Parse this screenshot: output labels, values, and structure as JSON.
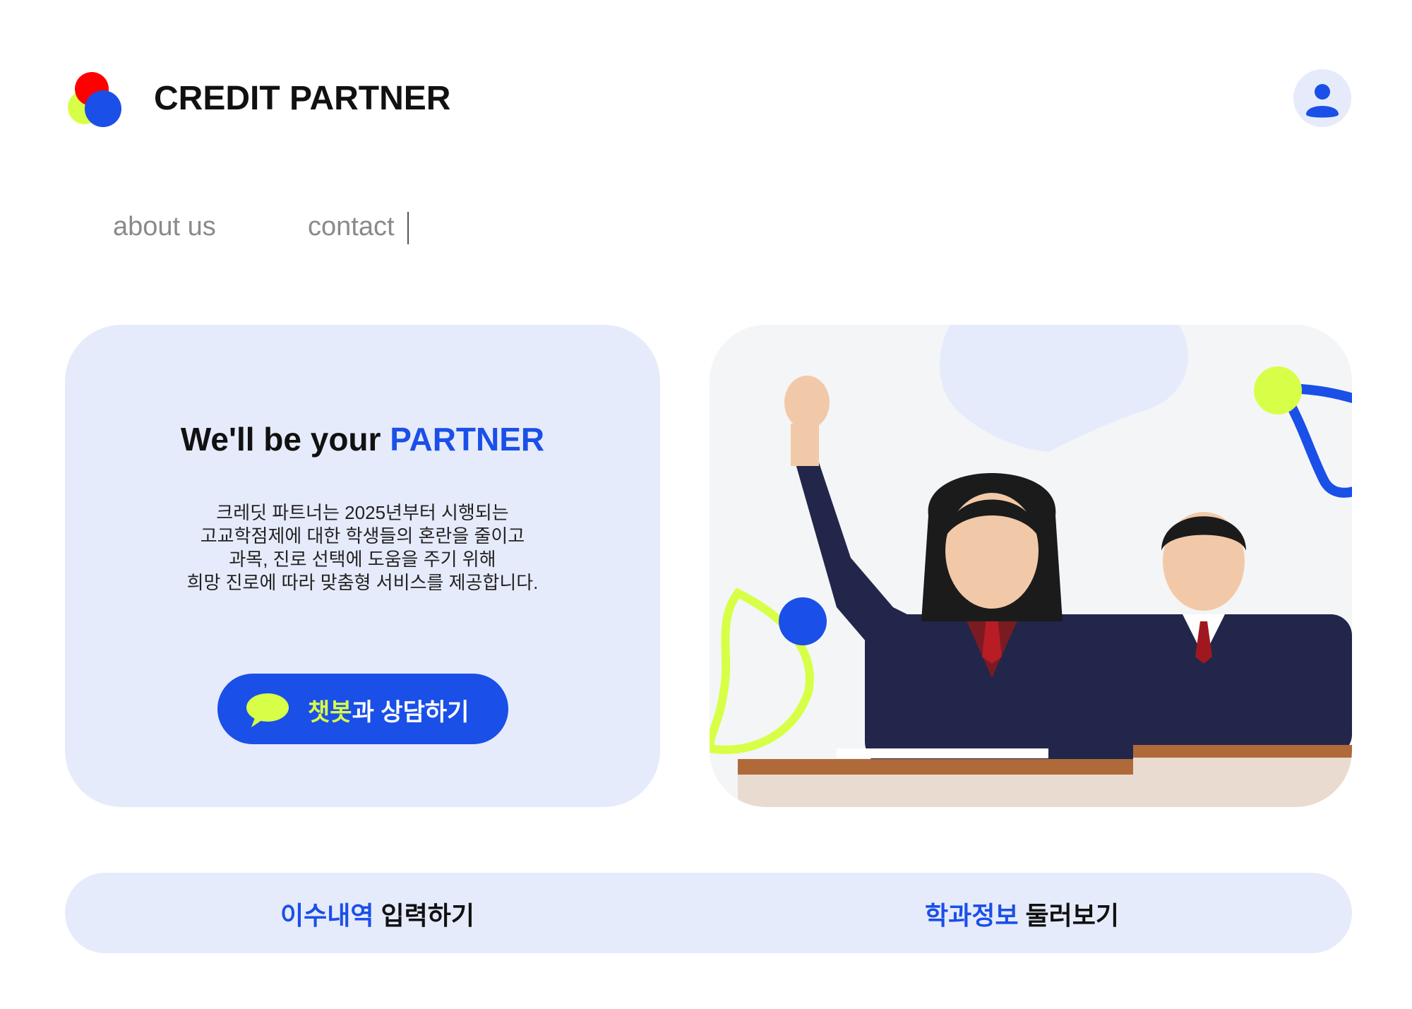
{
  "header": {
    "brand": "CREDIT PARTNER",
    "logo_icon": "overlapping-circles-logo",
    "user_icon": "user-icon"
  },
  "nav": {
    "items": [
      {
        "label": "about us"
      },
      {
        "label": "contact"
      }
    ]
  },
  "hero": {
    "title_prefix": "We'll be your ",
    "title_accent": "PARTNER",
    "description_lines": [
      "크레딧 파트너는 2025년부터 시행되는",
      "고교학점제에 대한 학생들의 혼란을 줄이고",
      "과목, 진로 선택에 도움을 주기 위해",
      "희망 진로에 따라 맞춤형 서비스를 제공합니다."
    ],
    "chat_button": {
      "highlight": "챗봇",
      "rest": "과 상담하기",
      "icon": "speech-bubble-icon"
    },
    "photo": {
      "subject": "students-in-classroom-photo"
    }
  },
  "bottom_bar": {
    "links": [
      {
        "highlight": "이수내역",
        "rest": " 입력하기"
      },
      {
        "highlight": "학과정보",
        "rest": " 둘러보기"
      }
    ]
  },
  "colors": {
    "accent_blue": "#1a4fe8",
    "light_blue_bg": "#e6ebfb",
    "lime": "#d8ff47",
    "red": "#ff0000"
  }
}
